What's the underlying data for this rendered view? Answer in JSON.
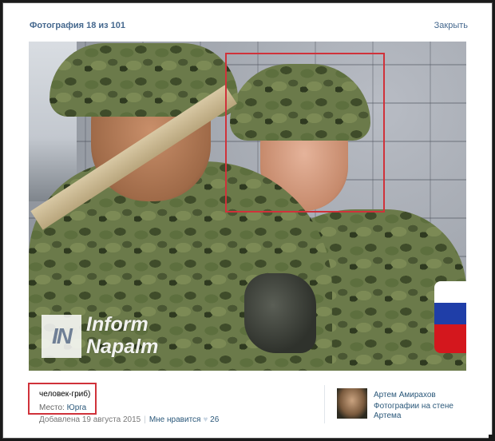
{
  "header": {
    "counter": "Фотография 18 из 101",
    "close_label": "Закрыть"
  },
  "watermark": {
    "logo": "IN",
    "line1": "Inform",
    "line2": "Napalm"
  },
  "caption": {
    "text": "человек-гриб)",
    "place_label": "Место:",
    "place_value": "Юрга"
  },
  "meta": {
    "added": "Добавлена 19 августа 2015",
    "like_label": "Мне нравится",
    "like_icon": "heart-icon",
    "like_count": "26"
  },
  "author": {
    "name": "Артем Амирахов",
    "wall_label": "Фотографии на стене Артема"
  },
  "colors": {
    "link": "#2b587a",
    "highlight": "#d0323a"
  }
}
